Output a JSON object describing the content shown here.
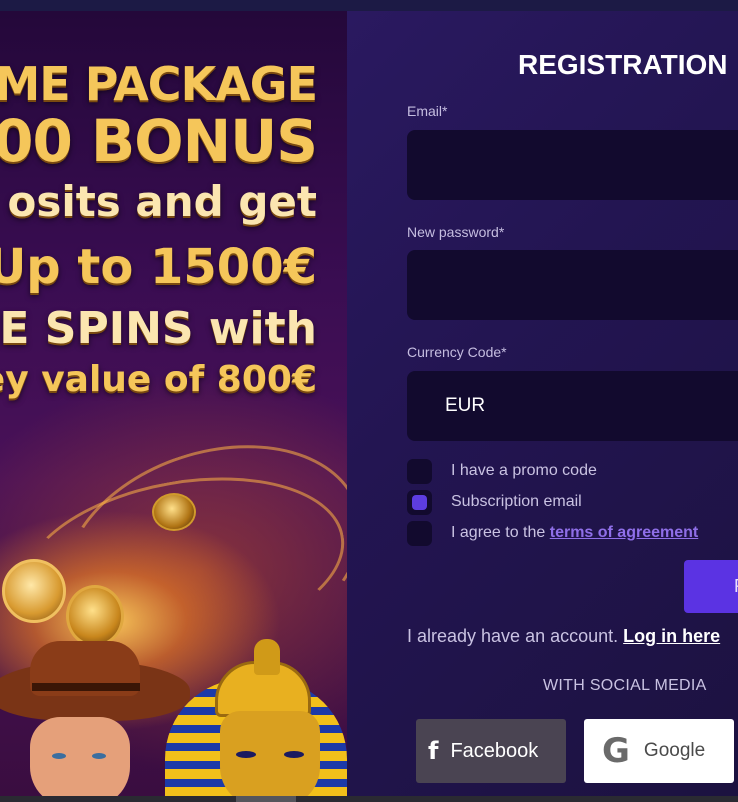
{
  "promo": {
    "lines": [
      "ME PACKAGE",
      "00 BONUS",
      "osits and get",
      "Up to 1500€",
      "EE SPINS with",
      "ey value of 800€"
    ]
  },
  "registration": {
    "title": "REGISTRATION",
    "email_label": "Email*",
    "email_value": "",
    "password_label": "New password*",
    "password_value": "",
    "currency_label": "Currency Code*",
    "currency_value": "EUR",
    "checkboxes": [
      {
        "label": "I have a promo code",
        "checked": false
      },
      {
        "label": "Subscription email",
        "checked": true
      },
      {
        "label": "I agree to the ",
        "link": "terms of agreement",
        "checked": false
      }
    ],
    "submit_label": "R",
    "account_text": "I already have an account.",
    "login_link": "Log in here",
    "social_heading": "WITH SOCIAL MEDIA",
    "facebook_icon": "f",
    "facebook_label": "Facebook",
    "google_icon": "G",
    "google_label": "Google"
  },
  "colors": {
    "accent": "#5b33e3",
    "panel": "#231552",
    "input_bg": "#120a2e",
    "promo_gold": "#f5c65a"
  }
}
